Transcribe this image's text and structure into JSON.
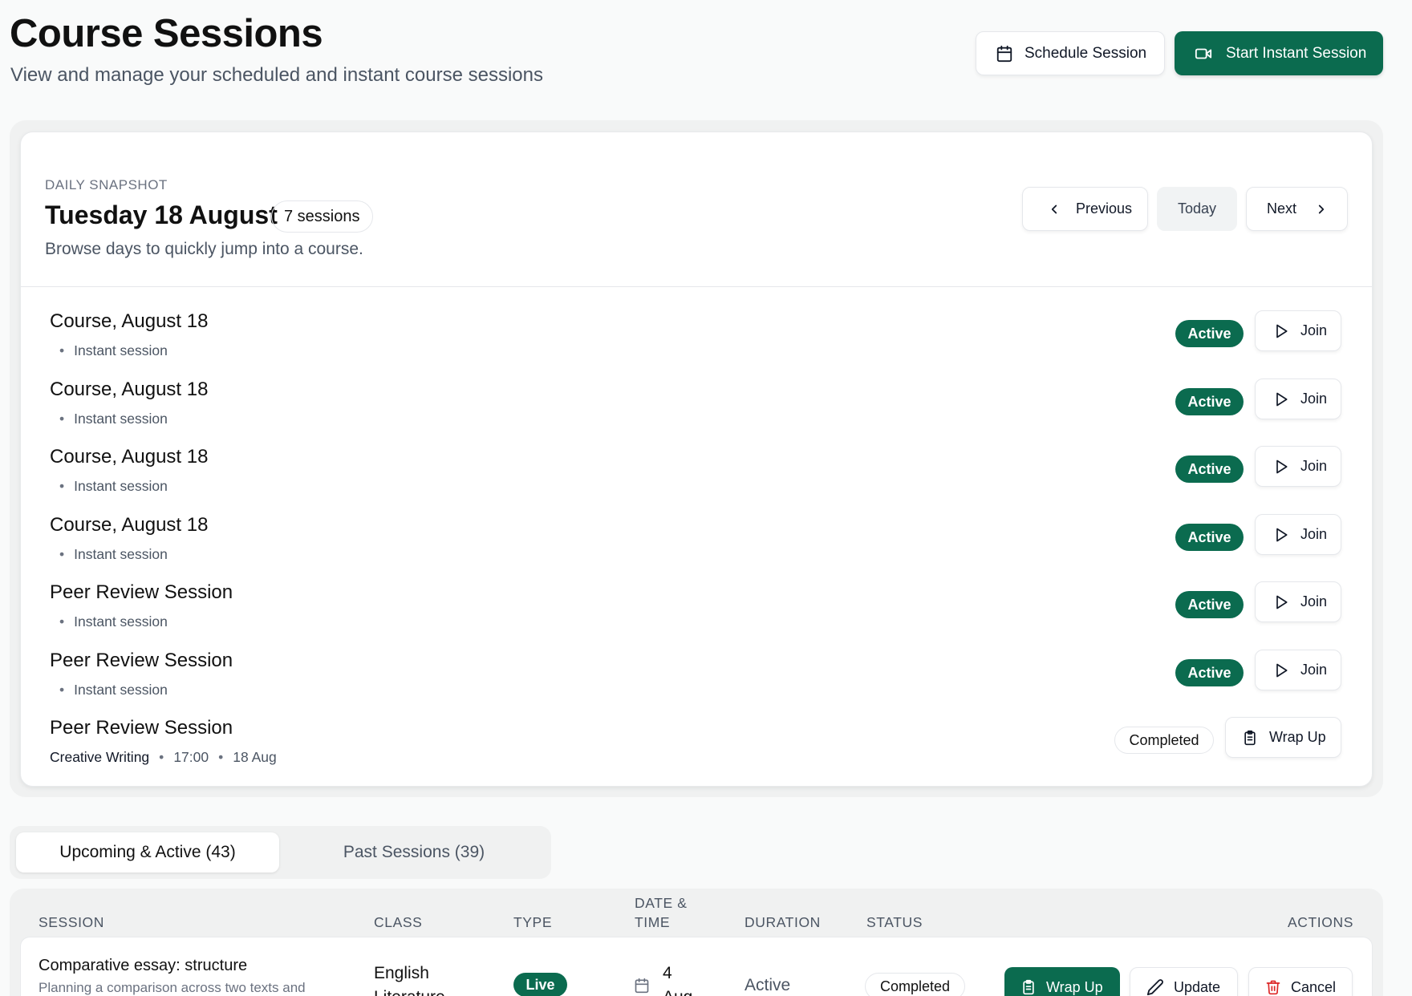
{
  "header": {
    "title": "Course Sessions",
    "subtitle": "View and manage your scheduled and instant course sessions",
    "schedule_label": "Schedule Session",
    "instant_label": "Start Instant Session"
  },
  "snapshot": {
    "kicker": "DAILY SNAPSHOT",
    "date": "Tuesday 18 August",
    "count": "7 sessions",
    "help": "Browse days to quickly jump into a course.",
    "previous_label": "Previous",
    "today_label": "Today",
    "next_label": "Next",
    "sessions": [
      {
        "title": "Course, August 18",
        "meta": "Instant session",
        "status": "Active",
        "action": "Join"
      },
      {
        "title": "Course, August 18",
        "meta": "Instant session",
        "status": "Active",
        "action": "Join"
      },
      {
        "title": "Course, August 18",
        "meta": "Instant session",
        "status": "Active",
        "action": "Join"
      },
      {
        "title": "Course, August 18",
        "meta": "Instant session",
        "status": "Active",
        "action": "Join"
      },
      {
        "title": "Peer Review Session",
        "meta": "Instant session",
        "status": "Active",
        "action": "Join"
      },
      {
        "title": "Peer Review Session",
        "meta": "Instant session",
        "status": "Active",
        "action": "Join"
      },
      {
        "title": "Peer Review Session",
        "class": "Creative Writing",
        "time": "17:00",
        "date": "18 Aug",
        "status": "Completed",
        "action": "Wrap Up"
      }
    ]
  },
  "tabs": {
    "upcoming": "Upcoming & Active (43)",
    "past": "Past Sessions (39)"
  },
  "table": {
    "headers": {
      "session": "SESSION",
      "class": "CLASS",
      "type": "TYPE",
      "date_line1": "DATE &",
      "date_line2": "TIME",
      "duration": "DURATION",
      "status": "STATUS",
      "actions": "ACTIONS"
    },
    "rows": [
      {
        "title": "Comparative essay: structure",
        "description": "Planning a comparison across two texts and",
        "class_line1": "English",
        "class_line2": "Literature",
        "type": "Live",
        "day": "4",
        "month": "Aug",
        "duration": "Active",
        "status": "Completed",
        "wrap_label": "Wrap Up",
        "update_label": "Update",
        "cancel_label": "Cancel"
      }
    ]
  },
  "colors": {
    "primary": "#0b6b4f",
    "cancel_icon": "#dc2626"
  }
}
